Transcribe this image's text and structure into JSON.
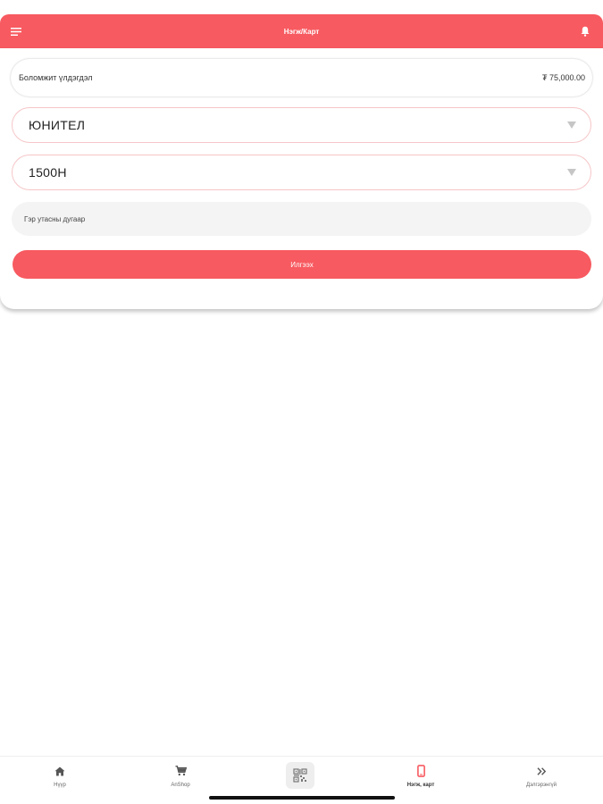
{
  "colors": {
    "accent": "#f75a60",
    "accent_border": "#f6c6c8",
    "input_bg": "#f4f4f4"
  },
  "header": {
    "title": "Нэгж/Карт",
    "menu_icon": "menu-icon",
    "bell_icon": "bell-icon"
  },
  "balance": {
    "label": "Боломжит үлдэгдэл",
    "amount": "₮ 75,000.00"
  },
  "operator_select": {
    "selected": "ЮНИТЕЛ"
  },
  "package_select": {
    "selected": "1500Н"
  },
  "phone_input": {
    "placeholder": "Гэр утасны дугаар",
    "value": ""
  },
  "submit": {
    "label": "Илгээх"
  },
  "bottom_nav": {
    "items": [
      {
        "label": "Нүүр",
        "icon": "home-icon"
      },
      {
        "label": "AnShop",
        "icon": "cart-icon"
      },
      {
        "label": "",
        "icon": "qr-code-icon"
      },
      {
        "label": "Нэгж, карт",
        "icon": "phone-icon",
        "active": true
      },
      {
        "label": "Дэлгэрэнгүй",
        "icon": "double-chevron-right-icon"
      }
    ]
  }
}
